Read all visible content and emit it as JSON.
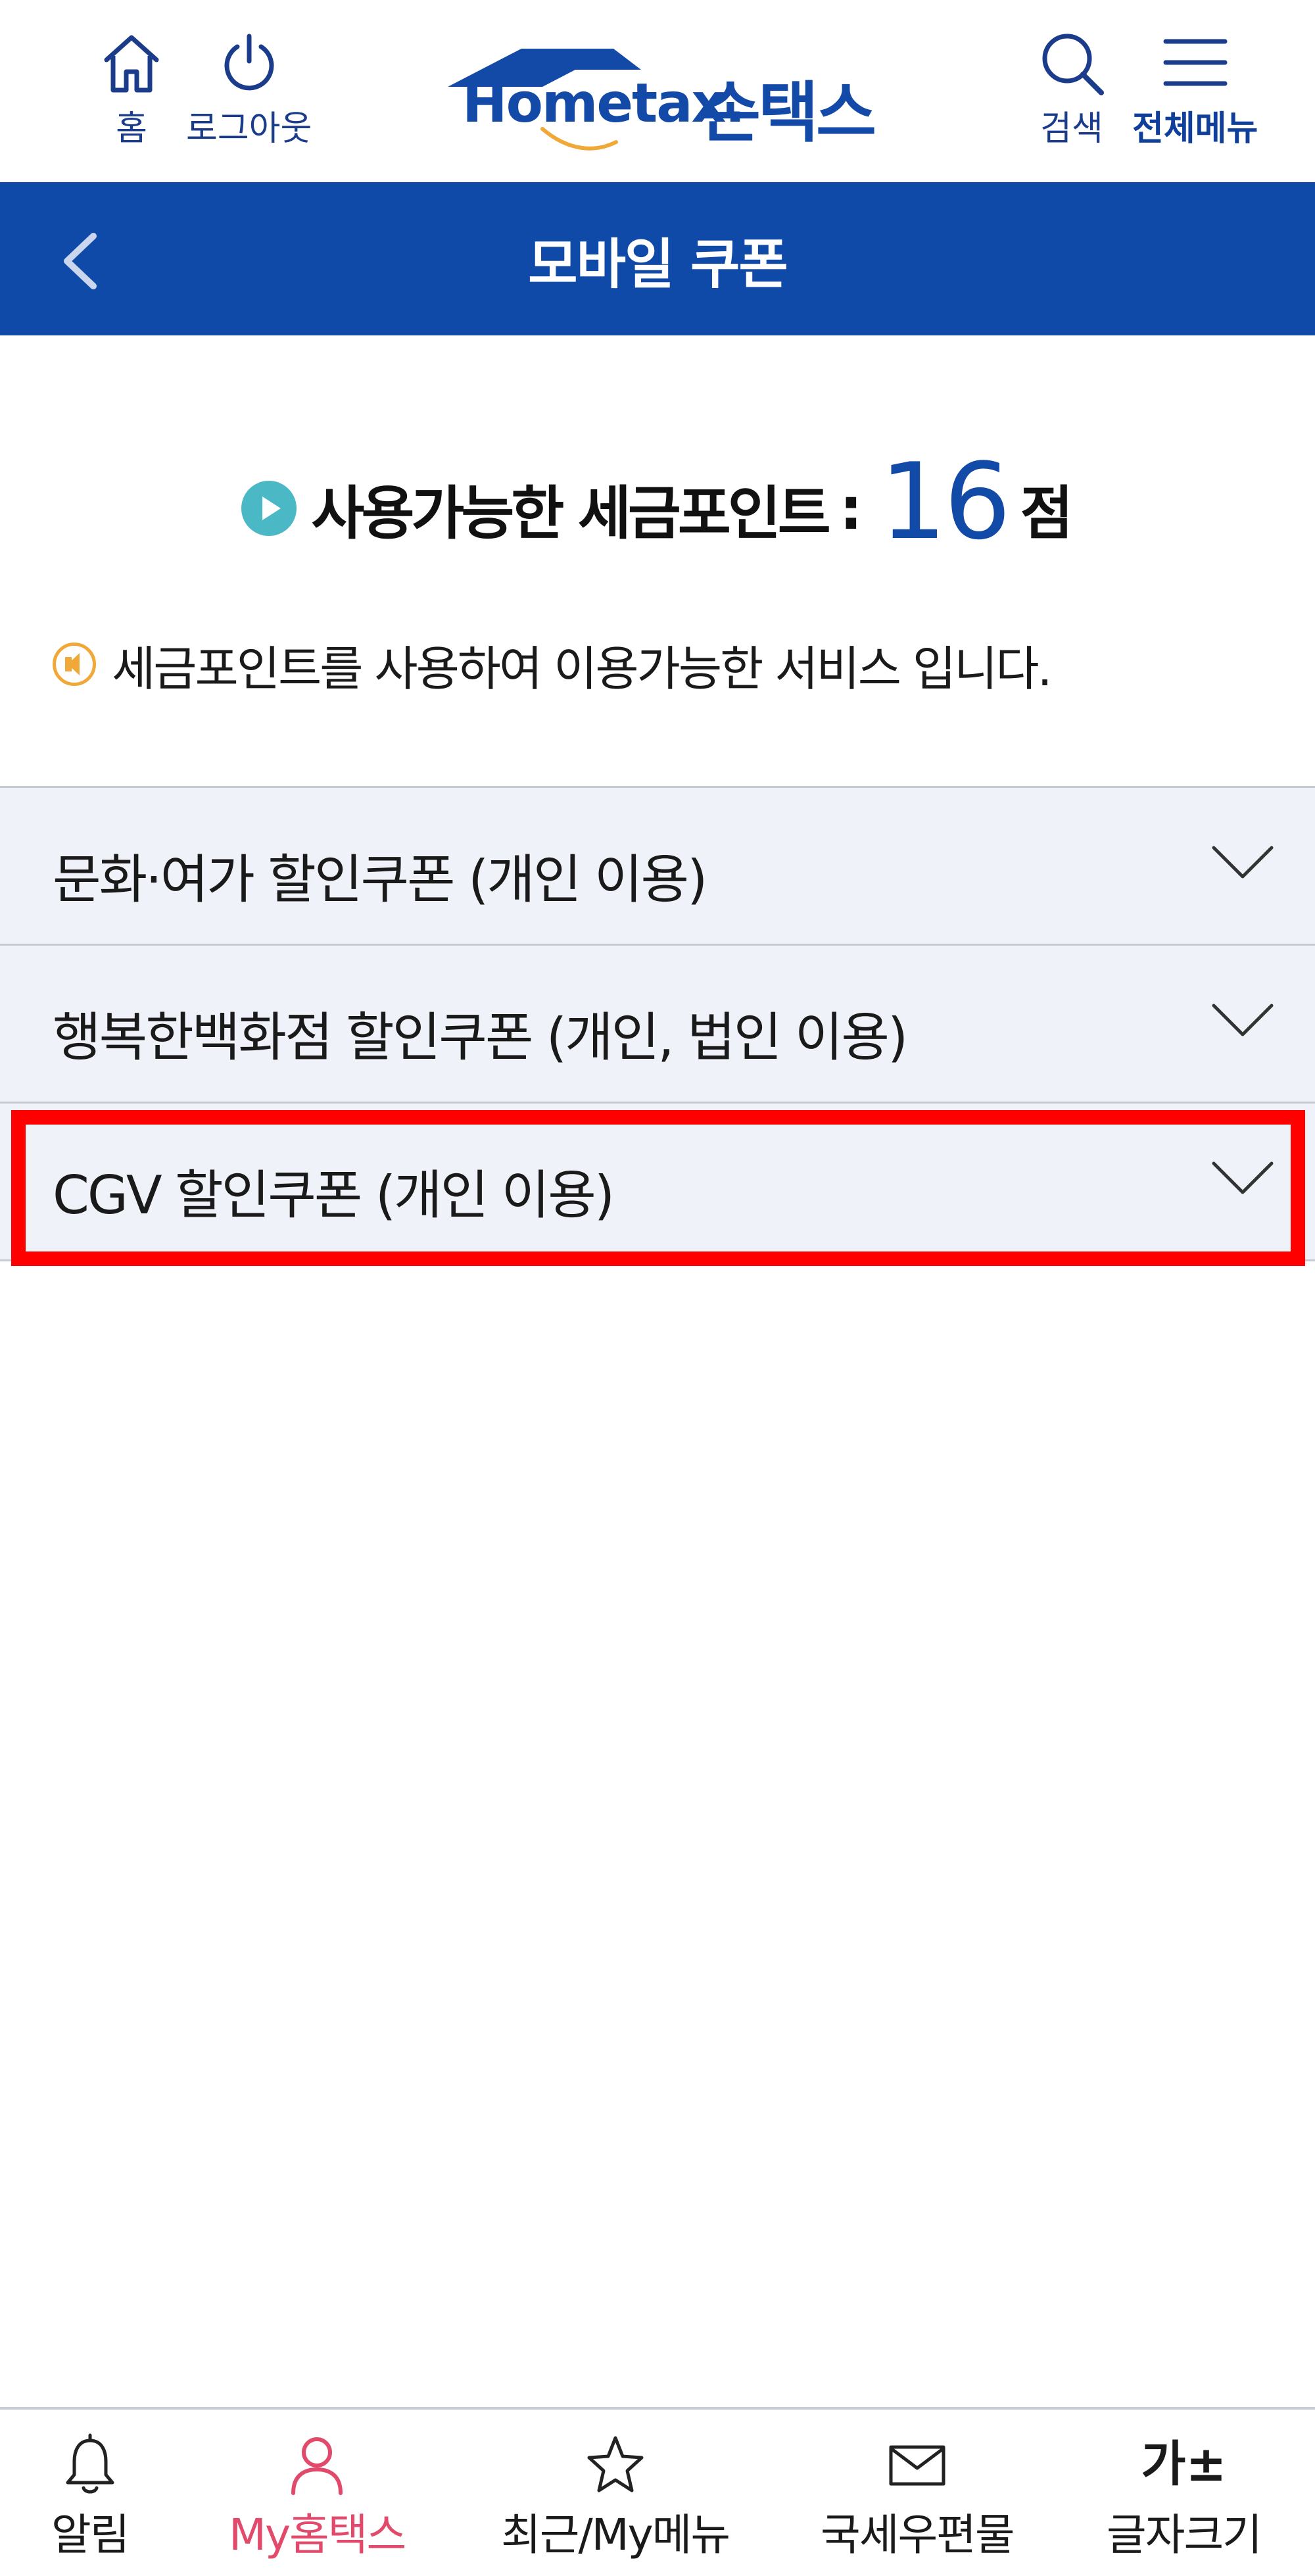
{
  "header": {
    "home_label": "홈",
    "logout_label": "로그아웃",
    "logo_text": "Hometax.",
    "logo_korean": "손택스",
    "search_label": "검색",
    "menu_label": "전체메뉴"
  },
  "title_bar": {
    "title": "모바일 쿠폰"
  },
  "points": {
    "label": "사용가능한 세금포인트",
    "colon": ":",
    "value": "16",
    "unit": "점"
  },
  "notice": {
    "text": "세금포인트를 사용하여 이용가능한 서비스 입니다."
  },
  "accordion": {
    "items": [
      {
        "label": "문화·여가 할인쿠폰 (개인 이용)"
      },
      {
        "label": "행복한백화점 할인쿠폰 (개인, 법인 이용)"
      },
      {
        "label": "CGV 할인쿠폰 (개인 이용)"
      }
    ]
  },
  "bottom_nav": {
    "items": [
      {
        "label": "알림",
        "icon": "bell-icon"
      },
      {
        "label": "My홈택스",
        "icon": "user-icon",
        "active": true
      },
      {
        "label": "최근/My메뉴",
        "icon": "star-icon"
      },
      {
        "label": "국세우편물",
        "icon": "mail-icon"
      },
      {
        "label": "글자크기",
        "icon": "font-size-icon",
        "icon_text": "가±"
      }
    ]
  },
  "colors": {
    "brand_blue": "#0f4aa8",
    "accent_teal": "#4bb9c5",
    "notice_orange": "#f0a838",
    "active_pink": "#e14a6b",
    "highlight_red": "#ff0000",
    "accordion_bg": "#eff2f8"
  }
}
